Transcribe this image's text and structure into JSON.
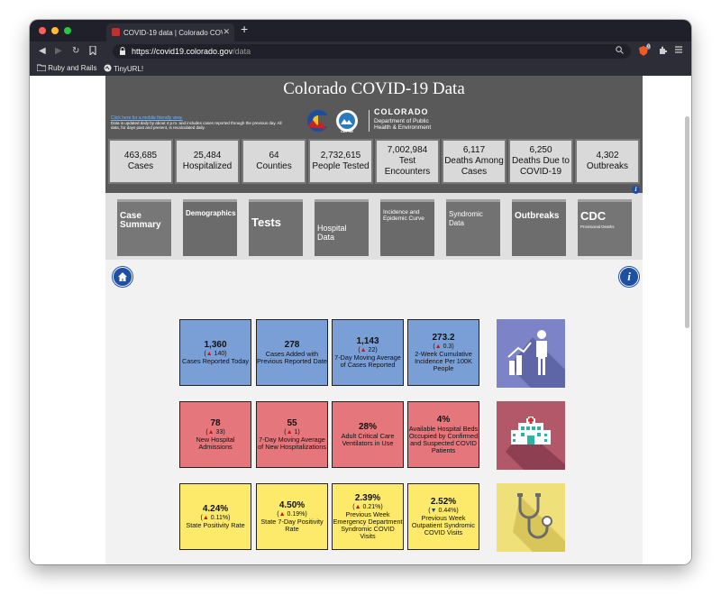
{
  "browser": {
    "tab_title": "COVID-19 data | Colorado COVI",
    "tab_close": "✕",
    "new_tab": "+",
    "url_host": "https://covid19.colorado.gov",
    "url_path": "/data",
    "brave_badge": "0",
    "bookmarks": [
      {
        "label": "Ruby and Rails",
        "icon": "folder-icon"
      },
      {
        "label": "TinyURL!",
        "icon": "globe-icon"
      }
    ]
  },
  "header": {
    "title": "Colorado COVID-19 Data",
    "mobile_link": "Click here for a mobile friendly view.",
    "note": "Data is updated daily by about 4 p.m. and includes cases reported through the previous day. All data, for days past and present, is recalculated daily.",
    "logo_state": "COLORADO",
    "logo_dept": "Department of Public",
    "logo_dept2": "Health & Environment",
    "logo_badge": "CDPHE"
  },
  "stats": [
    {
      "value": "463,685",
      "label": "Cases"
    },
    {
      "value": "25,484",
      "label": "Hospitalized"
    },
    {
      "value": "64",
      "label": "Counties"
    },
    {
      "value": "2,732,615",
      "label": "People Tested"
    },
    {
      "value": "7,002,984",
      "label": "Test Encounters"
    },
    {
      "value": "6,117",
      "label": "Deaths Among Cases"
    },
    {
      "value": "6,250",
      "label": "Deaths Due to COVID-19"
    },
    {
      "value": "4,302",
      "label": "Outbreaks"
    }
  ],
  "nav_tiles": [
    {
      "label": "Case Summary",
      "color": "#777777"
    },
    {
      "label": "Demographics",
      "color": "#6b6b6b"
    },
    {
      "label": "Tests",
      "color": "#707070"
    },
    {
      "label": "Hospital Data",
      "color": "#6e6e6e"
    },
    {
      "label": "Incidence and Epidemic Curve",
      "color": "#6a6a6a"
    },
    {
      "label": "Syndromic Data",
      "color": "#727272"
    },
    {
      "label": "Outbreaks",
      "color": "#6d6d6d"
    },
    {
      "label": "CDC",
      "sub": "Provisional Deaths",
      "color": "#757575"
    }
  ],
  "cards_blue": [
    {
      "value": "1,360",
      "change": "140",
      "dir": "up",
      "label": "Cases Reported Today"
    },
    {
      "value": "278",
      "change": "",
      "dir": "",
      "label": "Cases Added with Previous Reported Date"
    },
    {
      "value": "1,143",
      "change": "22",
      "dir": "up",
      "label": "7-Day Moving Average of Cases Reported"
    },
    {
      "value": "273.2",
      "change": "0.3",
      "dir": "up",
      "label": "2-Week Cumulative Incidence Per 100K People"
    }
  ],
  "cards_red": [
    {
      "value": "78",
      "change": "33",
      "dir": "up",
      "label": "New Hospital Admissions"
    },
    {
      "value": "55",
      "change": "1",
      "dir": "up",
      "label": "7-Day Moving Average of New Hospitalizations"
    },
    {
      "value": "28%",
      "change": "",
      "dir": "",
      "label": "Adult Critical Care Ventilators in Use"
    },
    {
      "value": "4%",
      "change": "",
      "dir": "",
      "label": "Available Hospital Beds Occupied by Confirmed and Suspected COVID Patients"
    }
  ],
  "cards_yellow": [
    {
      "value": "4.24%",
      "change": "0.11%",
      "dir": "up",
      "label": "State Positivity Rate"
    },
    {
      "value": "4.50%",
      "change": "0.19%",
      "dir": "up",
      "label": "State 7-Day Positivity Rate"
    },
    {
      "value": "2.39%",
      "change": "0.21%",
      "dir": "up",
      "label": "Previous Week Emergency Department Syndromic COVID Visits"
    },
    {
      "value": "2.52%",
      "change": "0.44%",
      "dir": "down",
      "label": "Previous Week Outpatient Syndromic COVID Visits"
    }
  ],
  "side_tiles": [
    {
      "icon": "growth-chart-person-icon",
      "color": "#7c83c6"
    },
    {
      "icon": "hospital-building-icon",
      "color": "#b35869"
    },
    {
      "icon": "stethoscope-icon",
      "color": "#f0e07a"
    }
  ],
  "colors": {
    "blue_card": "#7a9fd7",
    "red_card": "#e5767c",
    "yellow_card": "#fde96a",
    "up_arrow": "#cc1111",
    "down_arrow": "#1a3f8e"
  }
}
